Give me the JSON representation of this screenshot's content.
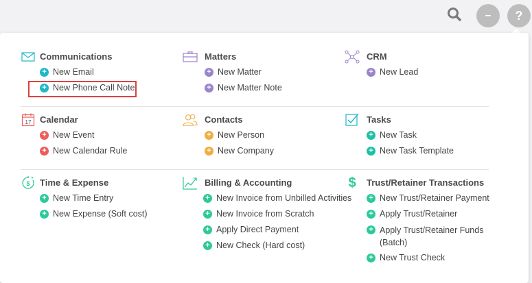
{
  "colors": {
    "teal": "#1fb8c9",
    "purple": "#9b85c9",
    "red": "#ee5c5c",
    "orange": "#f0ad40",
    "green": "#2ec99a",
    "highlight": "#d9433f"
  },
  "topbar": {
    "search_icon": "search-icon",
    "minus_label": "–",
    "help_label": "?"
  },
  "sections": {
    "communications": {
      "title": "Communications",
      "icon": "envelope-icon",
      "items": [
        "New Email",
        "New Phone Call Note"
      ]
    },
    "matters": {
      "title": "Matters",
      "icon": "briefcase-icon",
      "items": [
        "New Matter",
        "New Matter Note"
      ]
    },
    "crm": {
      "title": "CRM",
      "icon": "network-icon",
      "items": [
        "New Lead"
      ]
    },
    "calendar": {
      "title": "Calendar",
      "icon": "calendar-icon",
      "icon_text": "17",
      "items": [
        "New Event",
        "New Calendar Rule"
      ]
    },
    "contacts": {
      "title": "Contacts",
      "icon": "contacts-icon",
      "items": [
        "New Person",
        "New Company"
      ]
    },
    "tasks": {
      "title": "Tasks",
      "icon": "checkbox-icon",
      "items": [
        "New Task",
        "New Task Template"
      ]
    },
    "time_expense": {
      "title": "Time & Expense",
      "icon": "stopwatch-dollar-icon",
      "items": [
        "New Time Entry",
        "New Expense (Soft cost)"
      ]
    },
    "billing": {
      "title": "Billing & Accounting",
      "icon": "line-chart-icon",
      "items": [
        "New Invoice from Unbilled Activities",
        "New Invoice from Scratch",
        "Apply Direct Payment",
        "New Check (Hard cost)"
      ]
    },
    "trust": {
      "title": "Trust/Retainer Transactions",
      "icon": "dollar-icon",
      "items": [
        "New Trust/Retainer Payment",
        "Apply Trust/Retainer",
        "Apply Trust/Retainer Funds (Batch)",
        "New Trust Check"
      ]
    }
  }
}
